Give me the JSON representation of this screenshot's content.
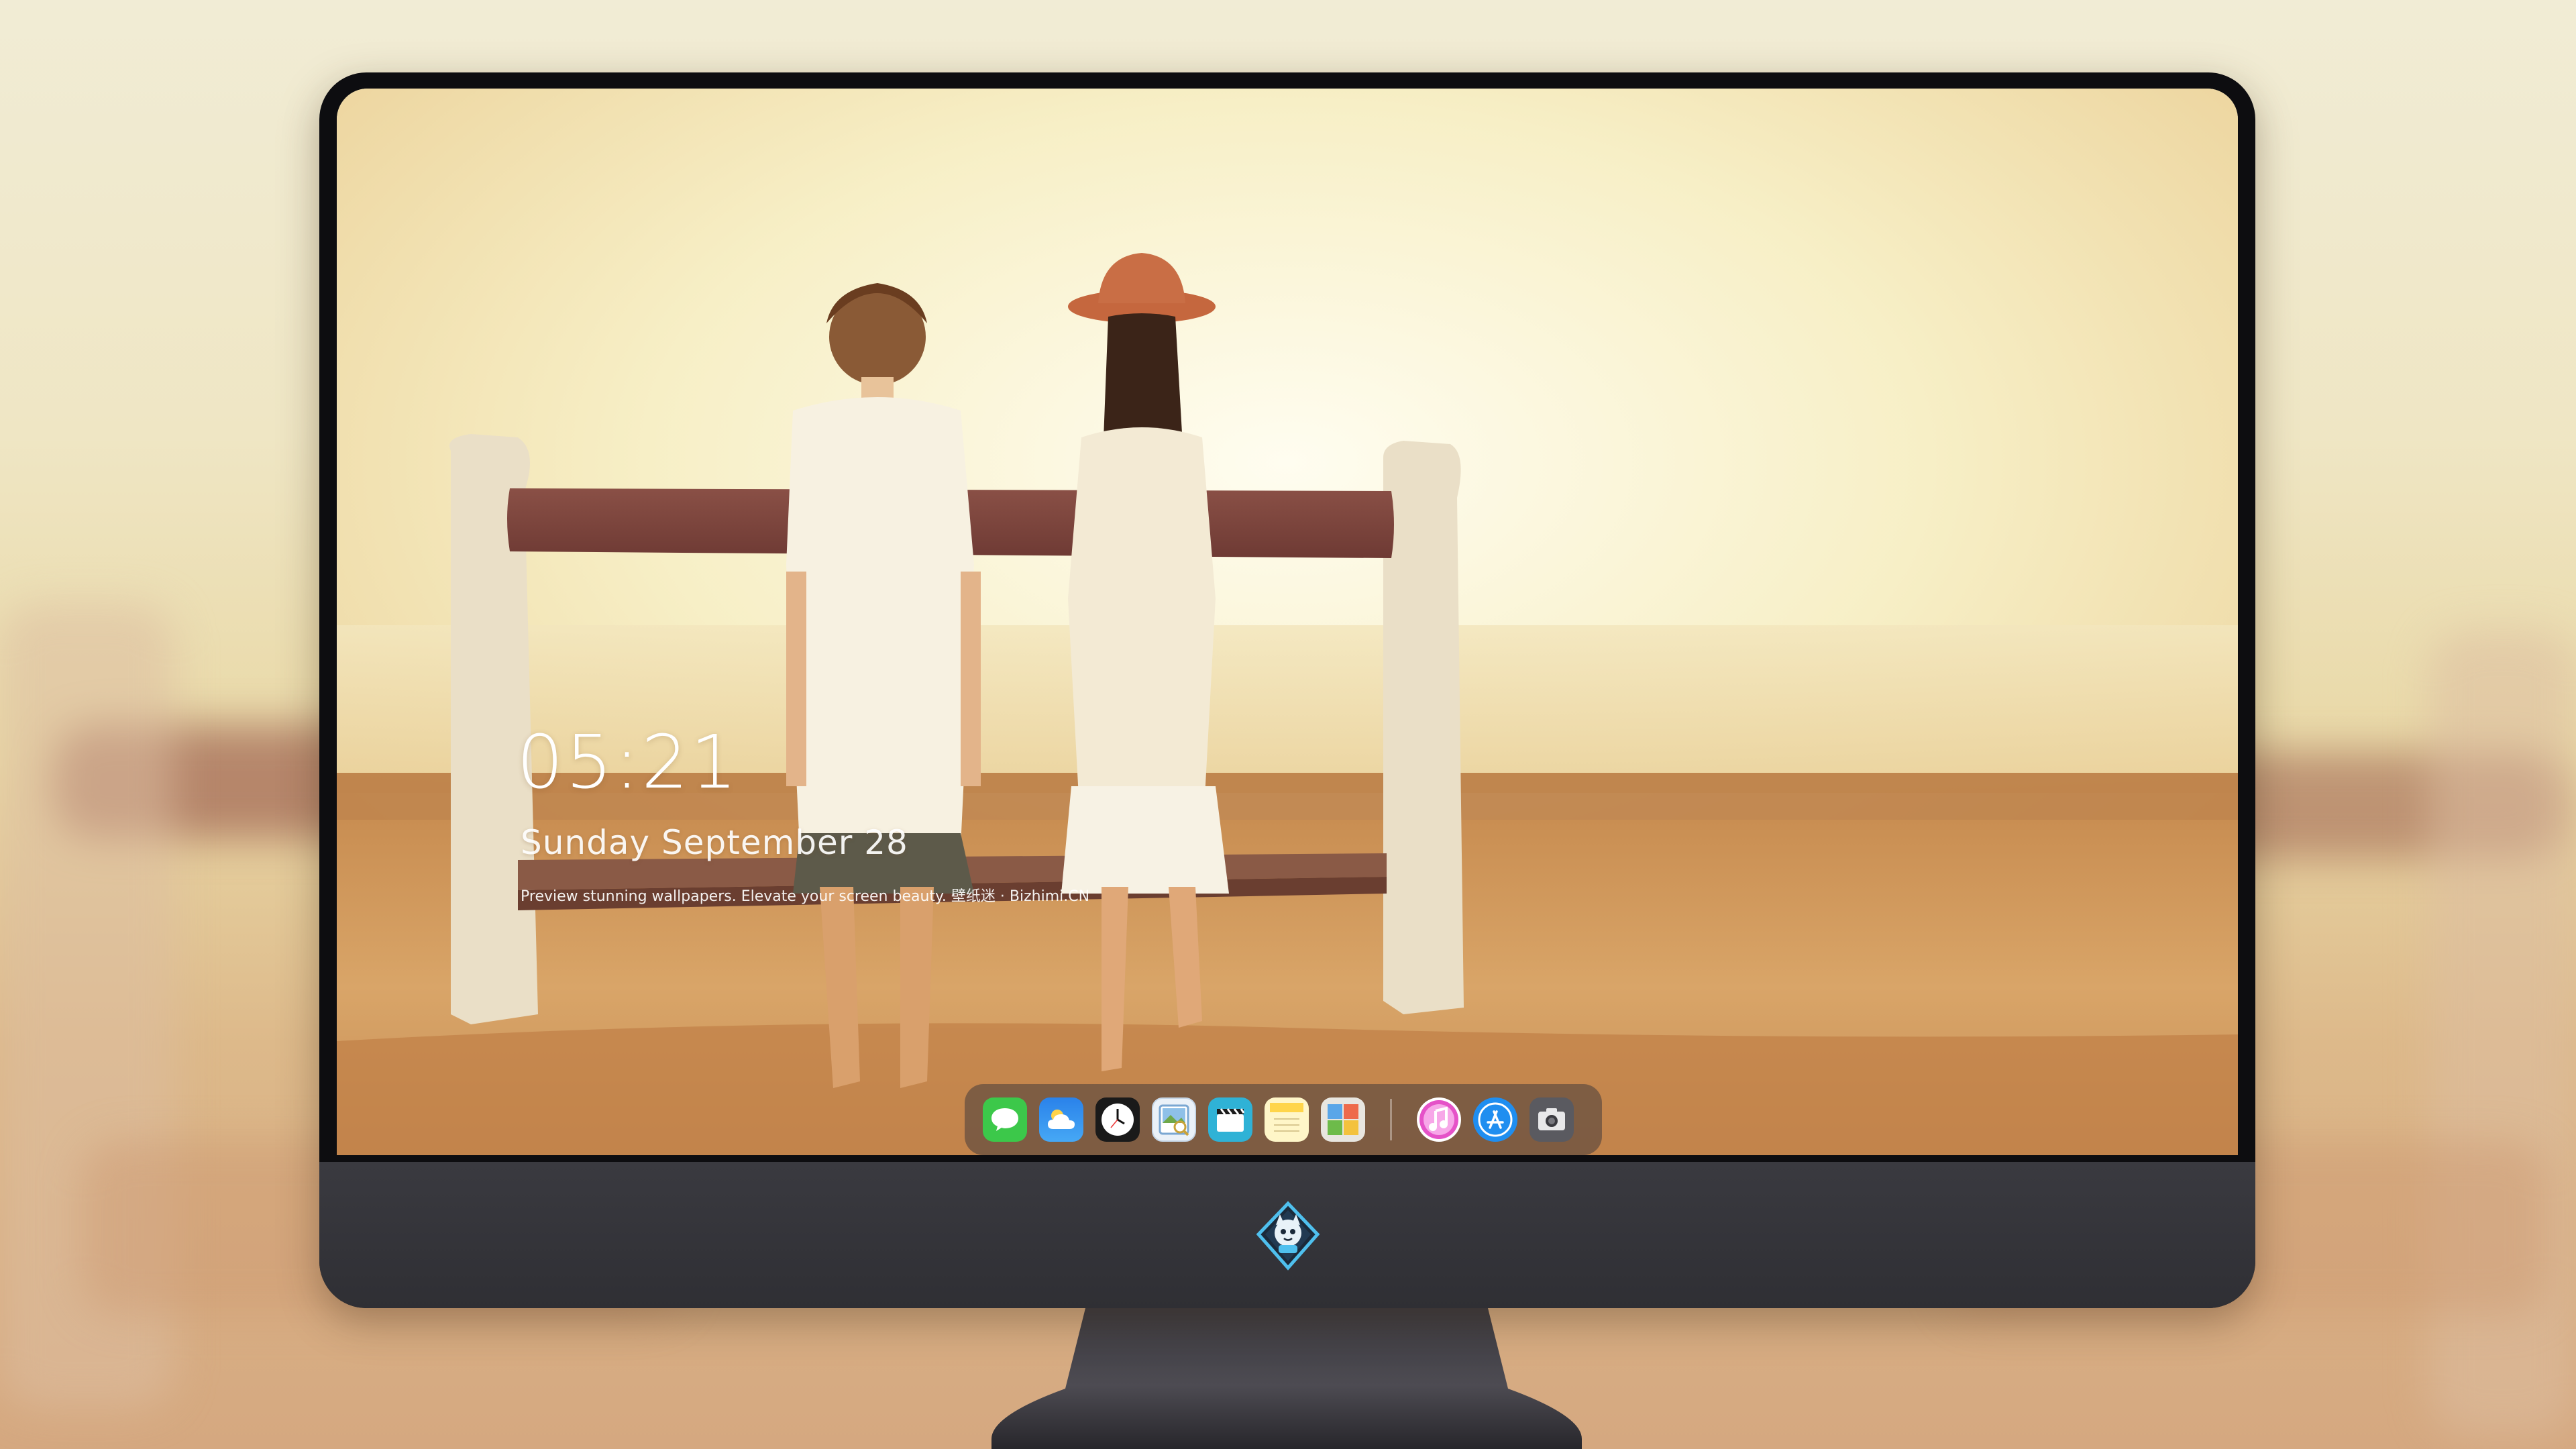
{
  "lockscreen": {
    "time": "05:21",
    "date": "Sunday September 28",
    "caption": "Preview stunning wallpapers. Elevate your screen beauty. 壁纸迷 · Bizhimi.CN"
  },
  "dock": {
    "apps": [
      {
        "name": "Messages",
        "icon": "chat-bubble-icon",
        "color": "#3cc84a"
      },
      {
        "name": "Weather",
        "icon": "weather-cloud-icon",
        "color": "#2e8ef0"
      },
      {
        "name": "Clock",
        "icon": "clock-icon",
        "color": "#1a1a1a"
      },
      {
        "name": "Preview",
        "icon": "preview-icon",
        "color": "#8ab4d8"
      },
      {
        "name": "Video",
        "icon": "clapperboard-icon",
        "color": "#33b6d8"
      },
      {
        "name": "Notes",
        "icon": "notes-icon",
        "color": "#ffd54a"
      },
      {
        "name": "Photo Booth",
        "icon": "photo-collage-icon",
        "color": "#e8e6e0"
      },
      {
        "name": "Music",
        "icon": "music-note-icon",
        "color": "#e552c8"
      },
      {
        "name": "App Store",
        "icon": "app-store-icon",
        "color": "#1f8ef0"
      },
      {
        "name": "Camera",
        "icon": "camera-icon",
        "color": "#5a5a60"
      }
    ]
  },
  "device": {
    "chin_logo": "mascot-logo-icon",
    "bezel_color": "#0d0d10",
    "chin_color": "#35353b"
  }
}
